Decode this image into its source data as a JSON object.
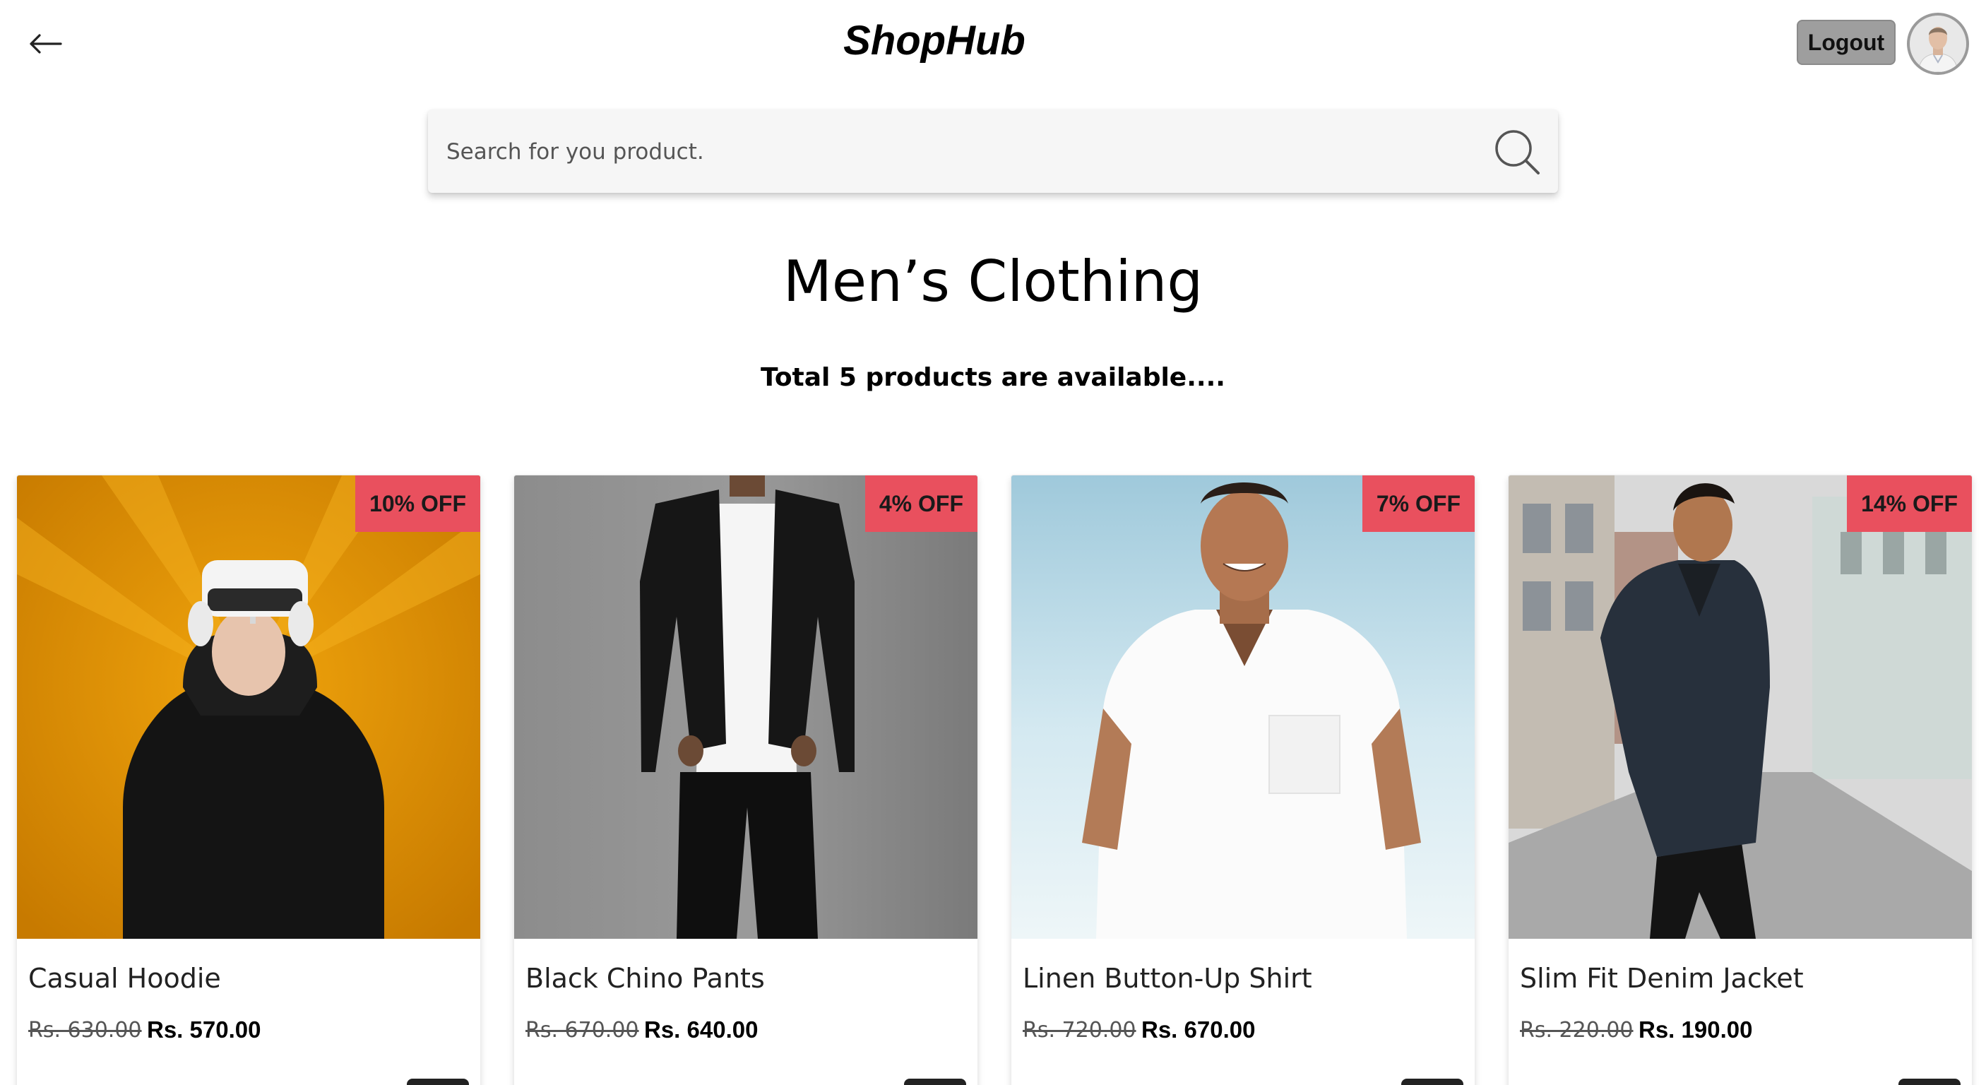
{
  "header": {
    "back_icon": "arrow-left-icon",
    "brand": "ShopHub",
    "logout_label": "Logout",
    "avatar_icon": "user-avatar"
  },
  "search": {
    "placeholder": "Search for you product.",
    "value": "",
    "icon": "search-icon"
  },
  "category": {
    "title": "Men’s Clothing",
    "subtitle": "Total 5 products are available...."
  },
  "colors": {
    "badge": "#e9505e",
    "logout_bg": "#9e9e9e"
  },
  "products": [
    {
      "name": "Casual Hoodie",
      "old_price": "Rs. 630.00",
      "new_price": "Rs. 570.00",
      "discount": "10% OFF"
    },
    {
      "name": "Black Chino Pants",
      "old_price": "Rs. 670.00",
      "new_price": "Rs. 640.00",
      "discount": "4% OFF"
    },
    {
      "name": "Linen Button-Up Shirt",
      "old_price": "Rs. 720.00",
      "new_price": "Rs. 670.00",
      "discount": "7% OFF"
    },
    {
      "name": "Slim Fit Denim Jacket",
      "old_price": "Rs. 220.00",
      "new_price": "Rs. 190.00",
      "discount": "14% OFF"
    }
  ]
}
